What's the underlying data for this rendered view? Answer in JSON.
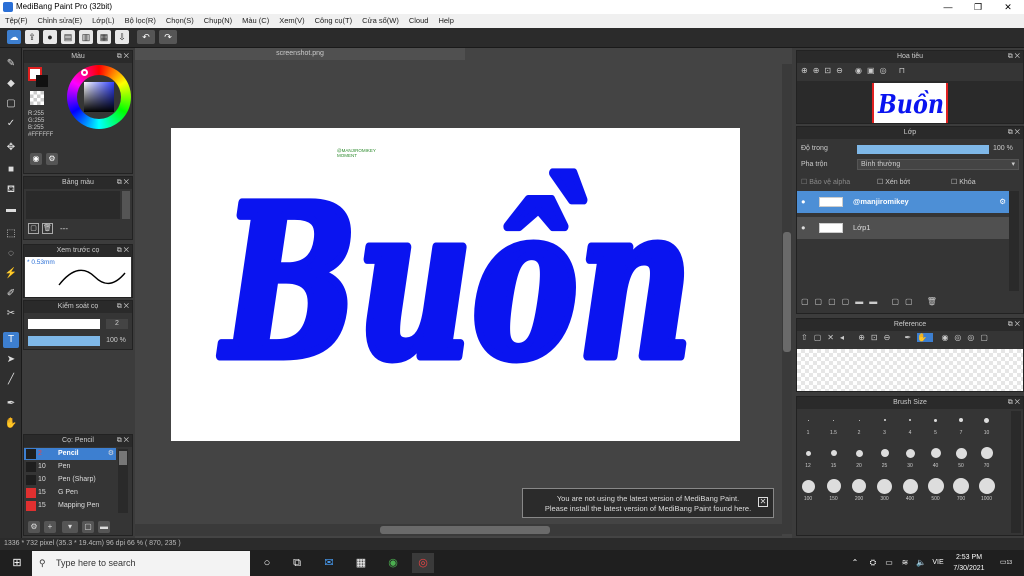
{
  "window": {
    "title": "MediBang Paint Pro (32bit)"
  },
  "menu": [
    "Tệp(F)",
    "Chỉnh sửa(E)",
    "Lớp(L)",
    "Bộ lọc(R)",
    "Chọn(S)",
    "Chụp(N)",
    "Màu (C)",
    "Xem(V)",
    "Công cụ(T)",
    "Cửa sổ(W)",
    "Cloud",
    "Help"
  ],
  "panels": {
    "color": {
      "title": "Màu",
      "rgb": [
        "R:255",
        "G:255",
        "B:255"
      ],
      "hex": "#FFFFFF"
    },
    "palette": {
      "title": "Bảng màu",
      "dash": "---"
    },
    "preview": {
      "title": "Xem trước cọ",
      "size": "* 0.53mm"
    },
    "control": {
      "title": "Kiểm soát cọ",
      "size_value": "2",
      "opacity": "100 %"
    },
    "brush": {
      "title": "Cọ: Pencil",
      "items": [
        {
          "size": "2",
          "label": "Pencil",
          "color": "#1e1e1e"
        },
        {
          "size": "10",
          "label": "Pen",
          "color": "#1e1e1e"
        },
        {
          "size": "10",
          "label": "Pen (Sharp)",
          "color": "#1e1e1e"
        },
        {
          "size": "15",
          "label": "G Pen",
          "color": "#e03030"
        },
        {
          "size": "15",
          "label": "Mapping Pen",
          "color": "#e03030"
        }
      ]
    }
  },
  "canvas": {
    "tab": "screenshot.png",
    "watermark_line1": "@MANJIROMIKEY",
    "watermark_line2": "MOMENT",
    "artwork_text": "Buồn",
    "art_color": "#0a14f0"
  },
  "navigator": {
    "title": "Hoa tiêu"
  },
  "layers": {
    "title": "Lớp",
    "opacity_label": "Độ trong",
    "opacity_value": "100 %",
    "blend_label": "Pha trộn",
    "blend_value": "Bình thường",
    "protect_alpha": "Bảo vệ alpha",
    "clipping": "Xén bớt",
    "lock": "Khóa",
    "items": [
      {
        "name": "@manjiromikey",
        "selected": true
      },
      {
        "name": "Lớp1",
        "selected": false
      }
    ]
  },
  "reference": {
    "title": "Reference"
  },
  "brush_size": {
    "title": "Brush Size",
    "rows": [
      [
        "1",
        "1.5",
        "2",
        "3",
        "4",
        "5",
        "7",
        "10"
      ],
      [
        "12",
        "15",
        "20",
        "25",
        "30",
        "40",
        "50",
        "70"
      ],
      [
        "100",
        "150",
        "200",
        "300",
        "400",
        "500",
        "700",
        "1000"
      ]
    ]
  },
  "notification": {
    "line1": "You are not using the latest version of MediBang Paint.",
    "line2": "Please install the latest version of MediBang Paint found here."
  },
  "status": {
    "text": "1336 * 732 pixel  (35.3 * 19.4cm)  96 dpi  66 %  ( 870, 235 )"
  },
  "taskbar": {
    "search_placeholder": "Type here to search",
    "time": "2:53 PM",
    "date": "7/30/2021",
    "lang": "VIE",
    "badge": "13"
  },
  "colors": {
    "accent": "#3d7fd0",
    "panel": "#353535",
    "canvas_bg": "#444444"
  }
}
